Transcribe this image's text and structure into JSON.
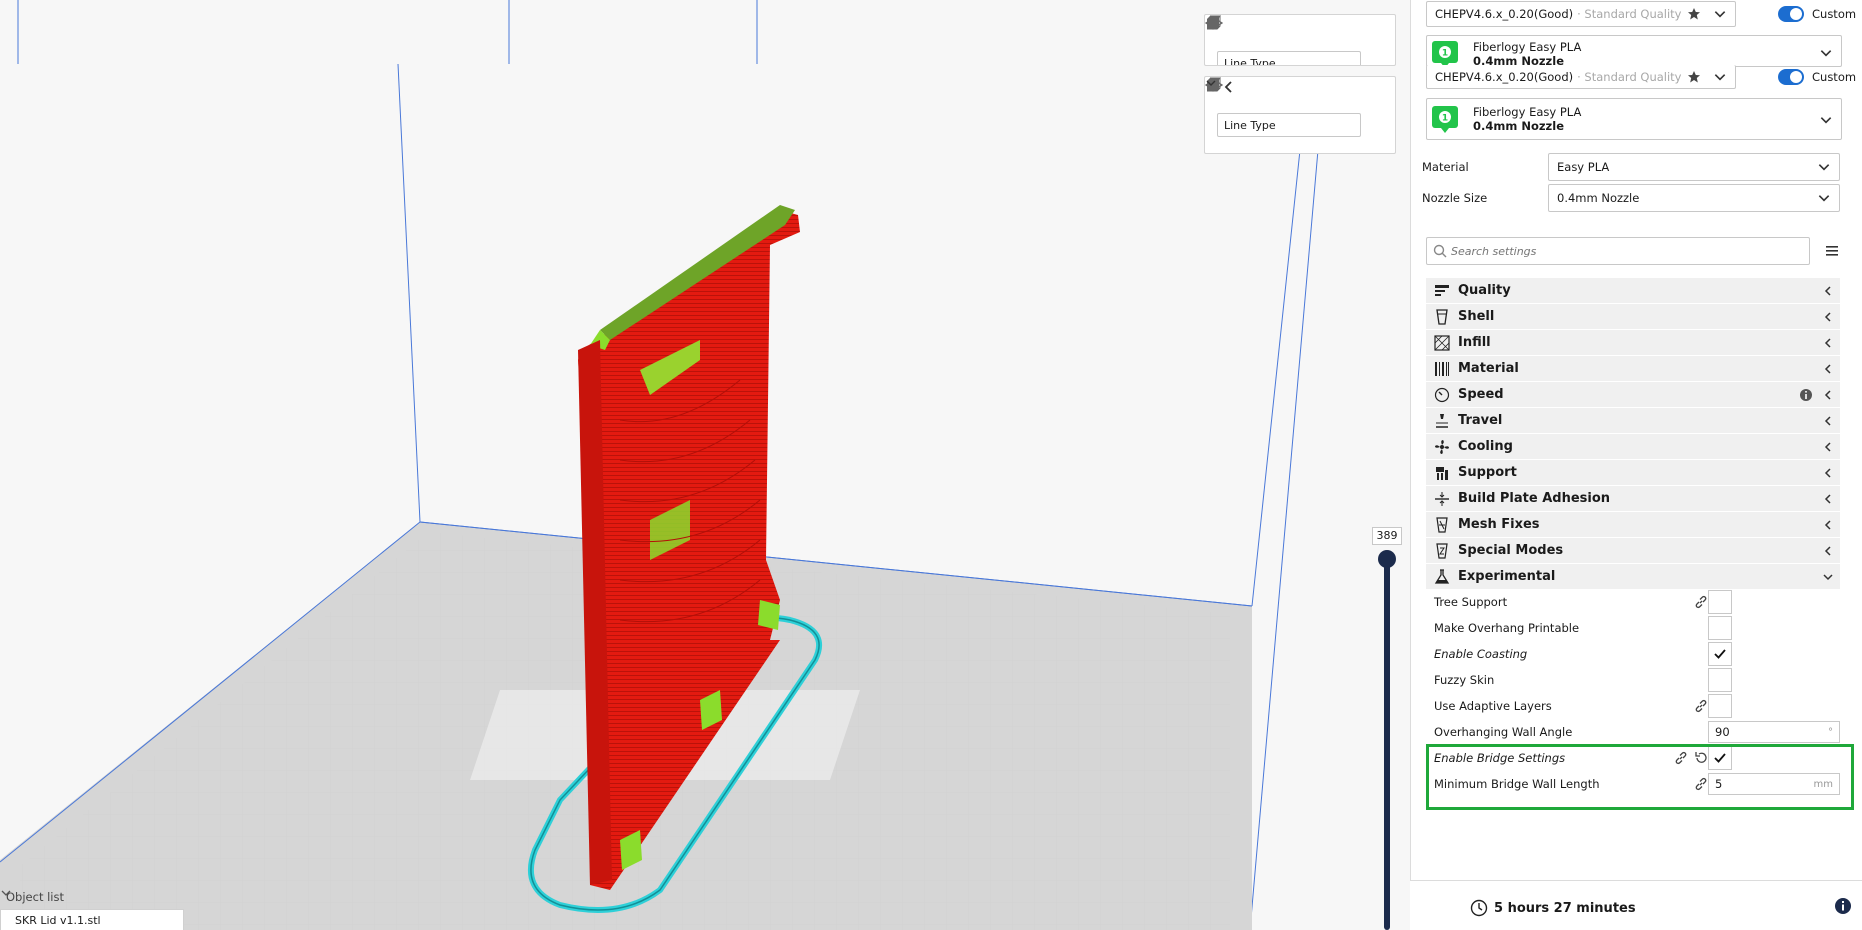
{
  "viewport": {
    "layer_value": "389",
    "view_modes": [
      "3d-view-icon",
      "front-view-icon",
      "top-view-icon",
      "left-view-icon",
      "right-view-icon",
      "xray-view-icon"
    ],
    "line_type_ghost": "Line Type",
    "line_type": "Line Type"
  },
  "object_list": {
    "header": "Object list",
    "item": "SKR Lid v1.1.stl"
  },
  "profile": {
    "name": "CHEPV4.6.x_0.20(Good)",
    "quality": "· Standard Quality - 0...",
    "custom_label": "Custom"
  },
  "extruder": {
    "material_name": "Fiberlogy Easy PLA",
    "nozzle": "0.4mm Nozzle",
    "badge": "1"
  },
  "material_row": {
    "label": "Material",
    "value": "Easy PLA"
  },
  "nozzle_row": {
    "label": "Nozzle Size",
    "value": "0.4mm Nozzle"
  },
  "search": {
    "placeholder": "Search settings"
  },
  "categories": [
    {
      "label": "Quality",
      "icon": "quality-icon"
    },
    {
      "label": "Shell",
      "icon": "shell-icon"
    },
    {
      "label": "Infill",
      "icon": "infill-icon"
    },
    {
      "label": "Material",
      "icon": "material-icon"
    },
    {
      "label": "Speed",
      "icon": "speed-icon"
    },
    {
      "label": "Travel",
      "icon": "travel-icon"
    },
    {
      "label": "Cooling",
      "icon": "cooling-icon"
    },
    {
      "label": "Support",
      "icon": "support-icon"
    },
    {
      "label": "Build Plate Adhesion",
      "icon": "adhesion-icon"
    },
    {
      "label": "Mesh Fixes",
      "icon": "mesh-fixes-icon"
    },
    {
      "label": "Special Modes",
      "icon": "special-modes-icon"
    },
    {
      "label": "Experimental",
      "icon": "experimental-icon"
    }
  ],
  "experimental_settings": [
    {
      "label": "Tree Support",
      "type": "checkbox",
      "checked": false,
      "linked": true,
      "italic": false
    },
    {
      "label": "Make Overhang Printable",
      "type": "checkbox",
      "checked": false,
      "linked": false,
      "italic": false
    },
    {
      "label": "Enable Coasting",
      "type": "checkbox",
      "checked": true,
      "linked": false,
      "italic": true
    },
    {
      "label": "Fuzzy Skin",
      "type": "checkbox",
      "checked": false,
      "linked": false,
      "italic": false
    },
    {
      "label": "Use Adaptive Layers",
      "type": "checkbox",
      "checked": false,
      "linked": true,
      "italic": false
    },
    {
      "label": "Overhanging Wall Angle",
      "type": "input",
      "value": "90",
      "unit": "°",
      "linked": false,
      "italic": false
    },
    {
      "label": "Enable Bridge Settings",
      "type": "checkbox",
      "checked": true,
      "linked": true,
      "reset": true,
      "italic": true
    },
    {
      "label": "Minimum Bridge Wall Length",
      "type": "input",
      "value": "5",
      "unit": "mm",
      "linked": true,
      "italic": false
    }
  ],
  "print_info": {
    "time": "5 hours 27 minutes"
  },
  "colors": {
    "accent": "#1c6dd0",
    "model_red": "#e31a10",
    "model_green": "#8bdc2c",
    "skirt_cyan": "#2ed0d8",
    "highlight_green": "#1fa83a",
    "slider_navy": "#1c2b4c"
  }
}
